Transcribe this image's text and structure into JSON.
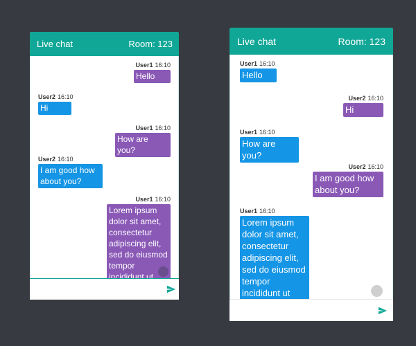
{
  "colors": {
    "background": "#373a40",
    "header": "#11a797",
    "purple": "#8a59b6",
    "blue": "#1595e5"
  },
  "left_chat": {
    "title": "Live chat",
    "room": "Room: 123",
    "messages": [
      {
        "user": "User1",
        "time": "16:10",
        "text": "Hello"
      },
      {
        "user": "User2",
        "time": "16:10",
        "text": "Hi"
      },
      {
        "user": "User1",
        "time": "16:10",
        "text": "How are you?"
      },
      {
        "user": "User2",
        "time": "16:10",
        "text": "I am good how about you?"
      },
      {
        "user": "User1",
        "time": "16:10",
        "text": "Lorem ipsum dolor sit amet, consectetur adipiscing elit, sed do eiusmod tempor incididunt ut"
      }
    ],
    "input_placeholder": "",
    "send_icon": "send-icon"
  },
  "right_chat": {
    "title": "Live chat",
    "room": "Room: 123",
    "messages": [
      {
        "user": "User1",
        "time": "16:10",
        "text": "Hello"
      },
      {
        "user": "User2",
        "time": "16:10",
        "text": "Hi"
      },
      {
        "user": "User1",
        "time": "16:10",
        "text": "How are you?"
      },
      {
        "user": "User2",
        "time": "16:10",
        "text": "I am good how about you?"
      },
      {
        "user": "User1",
        "time": "16:10",
        "text": "Lorem ipsum dolor sit amet, consectetur adipiscing elit, sed do eiusmod tempor incididunt ut"
      }
    ],
    "input_placeholder": "",
    "send_icon": "send-icon"
  }
}
